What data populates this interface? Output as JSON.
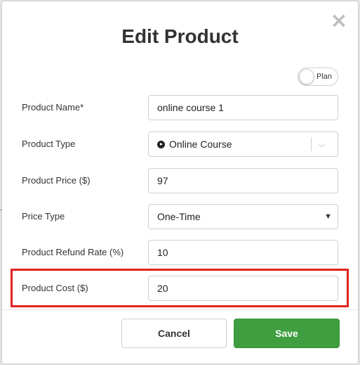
{
  "dialog": {
    "title": "Edit Product",
    "close_glyph": "×",
    "plan_toggle": {
      "label": "Plan",
      "on": false
    }
  },
  "form": {
    "product_name": {
      "label": "Product Name*",
      "value": "online course 1"
    },
    "product_type": {
      "label": "Product Type",
      "value": "Online Course",
      "icon": "play-circle-icon"
    },
    "product_price": {
      "label": "Product Price ($)",
      "value": "97"
    },
    "price_type": {
      "label": "Price Type",
      "value": "One-Time"
    },
    "refund_rate": {
      "label": "Product Refund Rate (%)",
      "value": "10"
    },
    "product_cost": {
      "label": "Product Cost ($)",
      "value": "20"
    }
  },
  "buttons": {
    "cancel": "Cancel",
    "save": "Save"
  },
  "colors": {
    "save": "#3f9e3f",
    "highlight": "#e02222",
    "close": "#bdbdbd"
  }
}
